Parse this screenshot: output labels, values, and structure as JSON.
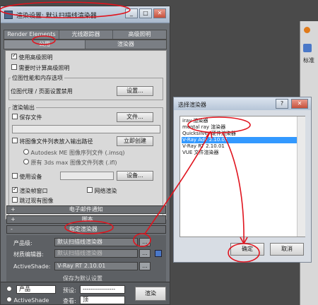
{
  "dialog": {
    "title": "渲染设置: 默认扫描线渲染器",
    "controls": {
      "minimize": "_",
      "maximize": "□",
      "close": "✕"
    },
    "tabs_row1": [
      "Render Elements",
      "光线跟踪器",
      "高级照明"
    ],
    "tabs_row2": [
      "公用",
      "渲染器"
    ],
    "options": {
      "use_adv_lighting": "使用高级照明",
      "compute_adv_lighting": "需要时计算高级照明"
    },
    "bitmap_group": {
      "title": "位图性能和内存选项",
      "text": "位图代理 / 页面设置禁用",
      "button": "设置..."
    },
    "render_output": {
      "title": "渲染输出",
      "save_file": "保存文件",
      "file_button": "文件...",
      "put_image": "将图像文件列表放入输出路径",
      "create_now_button": "立即创建",
      "radio_autodesk": "Autodesk ME 图像序列文件 (.imsq)",
      "radio_legacy": "原有 3ds max 图像文件列表 (.ifl)",
      "use_device": "使用设备",
      "device_button": "设备...",
      "render_frame_window": "渲染帧窗口",
      "net_render": "网络渲染",
      "skip_existing": "跳过现有图像"
    },
    "rollouts": {
      "email": "电子邮件通知",
      "script": "脚本",
      "assign_renderer": "指定渲染器"
    },
    "assign": {
      "production_label": "产品级:",
      "production_value": "默认扫描线渲染器",
      "material_label": "材质编辑器:",
      "material_value": "默认扫描线渲染器",
      "activeshade_label": "ActiveShade:",
      "activeshade_value": "V-Ray RT 2.10.01",
      "browse": "...",
      "save_default": "保存为默认设置"
    },
    "bottom": {
      "production": "产品",
      "activeshade": "ActiveShade",
      "preset_label": "预设:",
      "preset_value": "----------------",
      "view_label": "查看:",
      "view_value": "顶",
      "render_button": "渲染"
    }
  },
  "choose_dialog": {
    "title": "选择渲染器",
    "help": "?",
    "close": "✕",
    "items": [
      "iray 渲染器",
      "mental ray 渲染器",
      "Quicksilver 硬件渲染器",
      "V-Ray Adv 2.10.01",
      "V-Ray RT 2.10.01",
      "VUE 文件渲染器"
    ],
    "selected": "V-Ray Adv 2.10.01",
    "ok": "确定",
    "cancel": "取消"
  },
  "background": {
    "side_text": "标准"
  }
}
